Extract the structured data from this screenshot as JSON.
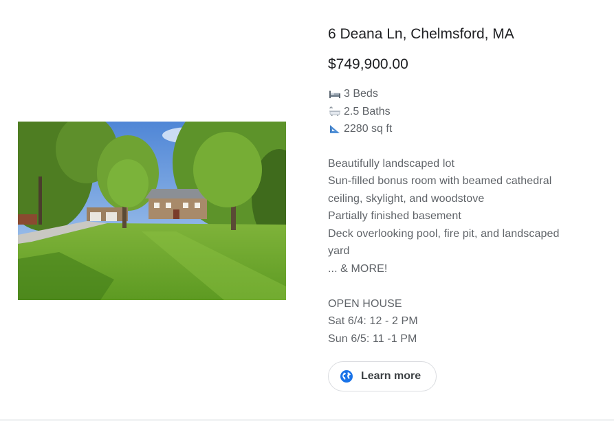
{
  "listing": {
    "address": "6 Deana Ln, Chelmsford, MA",
    "price": "$749,900.00",
    "specs": [
      {
        "icon": "bed-icon",
        "label": "3 Beds"
      },
      {
        "icon": "bathtub-icon",
        "label": "2.5 Baths"
      },
      {
        "icon": "triangular-ruler-icon",
        "label": "2280 sq ft"
      }
    ],
    "description": [
      "Beautifully landscaped lot",
      "Sun-filled bonus room with beamed cathedral",
      "ceiling, skylight, and woodstove",
      "Partially finished basement",
      "Deck overlooking pool, fire pit, and landscaped",
      "yard",
      "... & MORE!"
    ],
    "open_house": {
      "heading": "OPEN HOUSE",
      "times": [
        "Sat 6/4: 12 - 2 PM",
        "Sun 6/5: 11 -1 PM"
      ]
    },
    "cta": {
      "label": "Learn more",
      "icon": "globe-icon"
    }
  },
  "colors": {
    "title_text": "#202124",
    "body_text": "#5f6368",
    "globe_blue": "#1a73e8",
    "button_border": "#dadce0"
  }
}
